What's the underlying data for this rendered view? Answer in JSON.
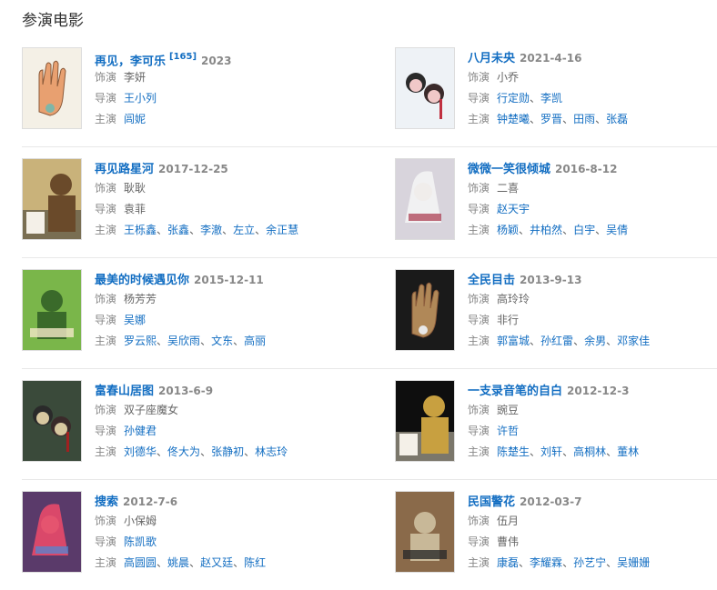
{
  "section_title": "参演电影",
  "labels": {
    "role": "饰演",
    "director": "导演",
    "stars": "主演",
    "sep": "、"
  },
  "movies": [
    {
      "title": "再见，李可乐",
      "ref": "[165]",
      "date": "2023",
      "role": "李妍",
      "role_link": false,
      "director": [
        "王小列"
      ],
      "director_link": true,
      "stars": [
        "闾妮"
      ],
      "poster": {
        "bg": "#f4f0e6",
        "accent": "#e8a070",
        "accent2": "#7fb6a8",
        "icon": "hand-poster-icon"
      }
    },
    {
      "title": "八月未央",
      "ref": "",
      "date": "2021-4-16",
      "role": "小乔",
      "role_link": false,
      "director": [
        "行定勋",
        "李凯"
      ],
      "director_link": true,
      "stars": [
        "钟楚曦",
        "罗晋",
        "田雨",
        "张磊"
      ],
      "poster": {
        "bg": "#eef2f6",
        "accent": "#f0c8c8",
        "accent2": "#c03040",
        "icon": "two-girls-poster-icon"
      }
    },
    {
      "title": "再见路星河",
      "ref": "",
      "date": "2017-12-25",
      "role": "耿耿",
      "role_link": false,
      "director": [
        "袁菲"
      ],
      "director_link": false,
      "stars": [
        "王栎鑫",
        "张鑫",
        "李澈",
        "左立",
        "余正慧"
      ],
      "poster": {
        "bg": "#c9b27a",
        "accent": "#6a4a2a",
        "accent2": "#2a2a2a",
        "icon": "couple-poster-icon"
      }
    },
    {
      "title": "微微一笑很倾城",
      "ref": "",
      "date": "2016-8-12",
      "role": "二喜",
      "role_link": false,
      "director": [
        "赵天宇"
      ],
      "director_link": true,
      "stars": [
        "杨颖",
        "井柏然",
        "白宇",
        "吴倩"
      ],
      "poster": {
        "bg": "#d8d4dc",
        "accent": "#f4f4f4",
        "accent2": "#a8344a",
        "icon": "fantasy-poster-icon"
      }
    },
    {
      "title": "最美的时候遇见你",
      "ref": "",
      "date": "2015-12-11",
      "role": "杨芳芳",
      "role_link": false,
      "director": [
        "吴娜"
      ],
      "director_link": true,
      "stars": [
        "罗云熙",
        "吴欣雨",
        "文东",
        "高丽"
      ],
      "poster": {
        "bg": "#7ab64a",
        "accent": "#f4e8c8",
        "accent2": "#3a6a2a",
        "icon": "campus-poster-icon"
      }
    },
    {
      "title": "全民目击",
      "ref": "",
      "date": "2013-9-13",
      "role": "高玲玲",
      "role_link": false,
      "director": [
        "非行"
      ],
      "director_link": false,
      "stars": [
        "郭富城",
        "孙红雷",
        "余男",
        "邓家佳"
      ],
      "poster": {
        "bg": "#1a1a1a",
        "accent": "#b08858",
        "accent2": "#e8e8e8",
        "icon": "thriller-poster-icon"
      }
    },
    {
      "title": "富春山居图",
      "ref": "",
      "date": "2013-6-9",
      "role": "双子座魔女",
      "role_link": false,
      "director": [
        "孙健君"
      ],
      "director_link": true,
      "stars": [
        "刘德华",
        "佟大为",
        "张静初",
        "林志玲"
      ],
      "poster": {
        "bg": "#3a4a3a",
        "accent": "#d8c8a0",
        "accent2": "#a02020",
        "icon": "action-poster-icon"
      }
    },
    {
      "title": "一支录音笔的自白",
      "ref": "",
      "date": "2012-12-3",
      "role": "豌豆",
      "role_link": false,
      "director": [
        "许哲"
      ],
      "director_link": true,
      "stars": [
        "陈楚生",
        "刘轩",
        "高桐林",
        "董林"
      ],
      "poster": {
        "bg": "#0e0e0e",
        "accent": "#c8a040",
        "accent2": "#e8e0c8",
        "icon": "recorder-poster-icon"
      }
    },
    {
      "title": "搜索",
      "ref": "",
      "date": "2012-7-6",
      "role": "小保姆",
      "role_link": false,
      "director": [
        "陈凯歌"
      ],
      "director_link": true,
      "stars": [
        "高圆圆",
        "姚晨",
        "赵又廷",
        "陈红"
      ],
      "poster": {
        "bg": "#5a3a6a",
        "accent": "#e84a6a",
        "accent2": "#4a8ad8",
        "icon": "search-poster-icon"
      }
    },
    {
      "title": "民国警花",
      "ref": "",
      "date": "2012-03-7",
      "role": "伍月",
      "role_link": false,
      "director": [
        "曹伟"
      ],
      "director_link": false,
      "stars": [
        "康磊",
        "李耀霖",
        "孙艺宁",
        "吴姗姗"
      ],
      "poster": {
        "bg": "#8a6a4a",
        "accent": "#2a2a2a",
        "accent2": "#c8b898",
        "icon": "republic-era-poster-icon"
      }
    }
  ]
}
